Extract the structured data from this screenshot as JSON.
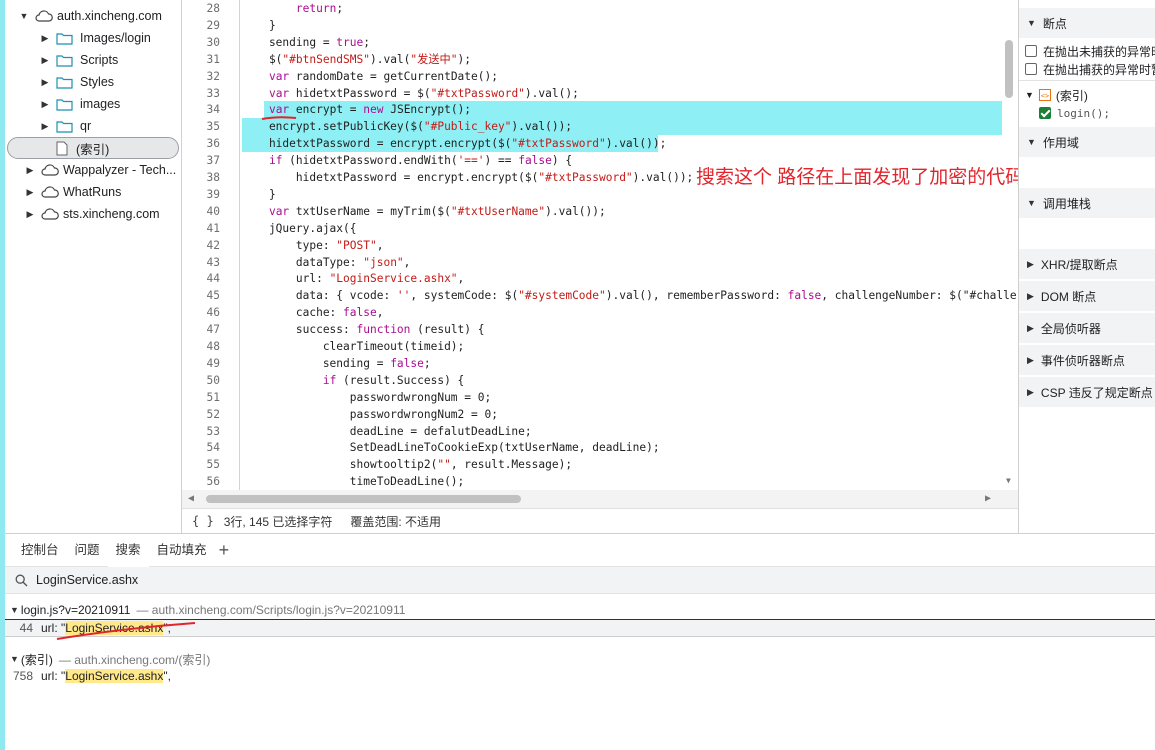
{
  "tree": {
    "items": [
      {
        "label": "auth.xincheng.com",
        "type": "domain",
        "expanded": true
      },
      {
        "label": "Images/login",
        "type": "folder"
      },
      {
        "label": "Scripts",
        "type": "folder"
      },
      {
        "label": "Styles",
        "type": "folder"
      },
      {
        "label": "images",
        "type": "folder"
      },
      {
        "label": "qr",
        "type": "folder"
      },
      {
        "label": "(索引)",
        "type": "file"
      },
      {
        "label": "Wappalyzer - Tech...",
        "type": "domain"
      },
      {
        "label": "WhatRuns",
        "type": "domain"
      },
      {
        "label": "sts.xincheng.com",
        "type": "domain"
      }
    ]
  },
  "code": {
    "lines": [
      {
        "n": "28",
        "text": "        return;"
      },
      {
        "n": "29",
        "text": "    }"
      },
      {
        "n": "30",
        "text": "    sending = true;"
      },
      {
        "n": "31",
        "text": "    $(\"#btnSendSMS\").val(\"发送中\");"
      },
      {
        "n": "32",
        "text": "    var randomDate = getCurrentDate();"
      },
      {
        "n": "33",
        "text": "    var hidetxtPassword = $(\"#txtPassword\").val();"
      },
      {
        "n": "34",
        "text": "    var encrypt = new JSEncrypt();"
      },
      {
        "n": "35",
        "text": "    encrypt.setPublicKey($(\"#Public_key\").val());"
      },
      {
        "n": "36",
        "text": "    hidetxtPassword = encrypt.encrypt($(\"#txtPassword\").val());"
      },
      {
        "n": "37",
        "text": "    if (hidetxtPassword.endWith('==') == false) {"
      },
      {
        "n": "38",
        "text": "        hidetxtPassword = encrypt.encrypt($(\"#txtPassword\").val());"
      },
      {
        "n": "39",
        "text": "    }"
      },
      {
        "n": "40",
        "text": "    var txtUserName = myTrim($(\"#txtUserName\").val());"
      },
      {
        "n": "41",
        "text": "    jQuery.ajax({"
      },
      {
        "n": "42",
        "text": "        type: \"POST\","
      },
      {
        "n": "43",
        "text": "        dataType: \"json\","
      },
      {
        "n": "44",
        "text": "        url: \"LoginService.ashx\","
      },
      {
        "n": "45",
        "text": "        data: { vcode: '', systemCode: $(\"#systemCode\").val(), rememberPassword: false, challengeNumber: $(\"#challe"
      },
      {
        "n": "46",
        "text": "        cache: false,"
      },
      {
        "n": "47",
        "text": "        success: function (result) {"
      },
      {
        "n": "48",
        "text": "            clearTimeout(timeid);"
      },
      {
        "n": "49",
        "text": "            sending = false;"
      },
      {
        "n": "50",
        "text": "            if (result.Success) {"
      },
      {
        "n": "51",
        "text": "                passwordwrongNum = 0;"
      },
      {
        "n": "52",
        "text": "                passwordwrongNum2 = 0;"
      },
      {
        "n": "53",
        "text": "                deadLine = defalutDeadLine;"
      },
      {
        "n": "54",
        "text": "                SetDeadLineToCookieExp(txtUserName, deadLine);"
      },
      {
        "n": "55",
        "text": "                showtooltip2(\"\", result.Message);"
      },
      {
        "n": "56",
        "text": "                timeToDeadLine();"
      }
    ]
  },
  "annotation": "搜索这个 路径在上面发现了加密的代码",
  "status": {
    "brace": "{ }",
    "selection": "3行, 145 已选择字符",
    "coverage": "覆盖范围: 不适用"
  },
  "right_panel": {
    "breakpoints_title": "断点",
    "pause_uncaught": "在抛出未捕获的异常时",
    "pause_caught": "在抛出捕获的异常时暂",
    "bp_file": "(索引)",
    "bp_code": "login();",
    "scope_title": "作用域",
    "callstack_title": "调用堆栈",
    "xhr_title": "XHR/提取断点",
    "dom_title": "DOM 断点",
    "global_title": "全局侦听器",
    "event_title": "事件侦听器断点",
    "csp_title": "CSP 违反了规定断点"
  },
  "drawer": {
    "tabs": [
      "控制台",
      "问题",
      "搜索",
      "自动填充"
    ],
    "active_tab": "搜索",
    "search_value": "LoginService.ashx",
    "results": [
      {
        "file": "login.js?v=20210911",
        "path": "— auth.xincheng.com/Scripts/login.js?v=20210911",
        "line": "44",
        "pre": "url: \"",
        "match": "LoginService.ashx",
        "post": "\","
      },
      {
        "file": "(索引)",
        "path": "— auth.xincheng.com/(索引)",
        "line": "758",
        "pre": "url: \"",
        "match": "LoginService.ashx",
        "post": "\","
      }
    ]
  },
  "colors": {
    "highlight": "#8ef0f4",
    "annotation": "#e3242b",
    "match": "#ffe98a"
  }
}
